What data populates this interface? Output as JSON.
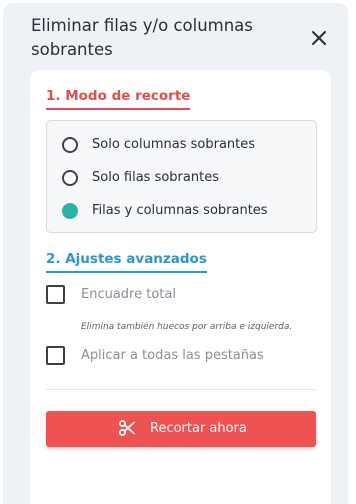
{
  "dialog": {
    "title": "Eliminar filas y/o columnas sobrantes"
  },
  "section_mode": {
    "title": "1. Modo de recorte",
    "options": [
      {
        "label": "Solo columnas sobrantes",
        "selected": false
      },
      {
        "label": "Solo filas sobrantes",
        "selected": false
      },
      {
        "label": "Filas y columnas sobrantes",
        "selected": true
      }
    ]
  },
  "section_advanced": {
    "title": "2. Ajustes avanzados",
    "full_frame_label": "Encuadre total",
    "full_frame_checked": false,
    "full_frame_hint": "Elimina también huecos por arriba e izquierda.",
    "all_tabs_label": "Aplicar a todas las pestañas",
    "all_tabs_checked": false
  },
  "actions": {
    "cut_now_label": "Recortar ahora"
  },
  "colors": {
    "accent_red": "#ee5352",
    "section1_red": "#e0504d",
    "section2_blue": "#2b97d8",
    "radio_selected": "#28b3a6"
  },
  "icons": {
    "close": "close-icon",
    "cut": "scissors-icon"
  }
}
